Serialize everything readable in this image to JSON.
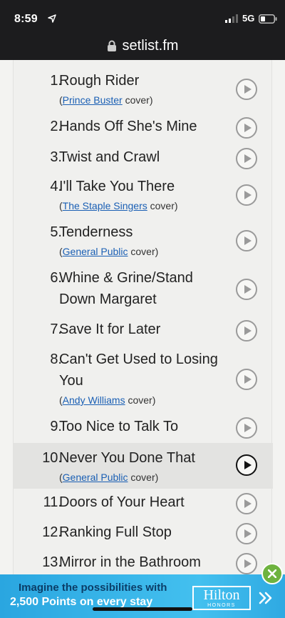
{
  "status_bar": {
    "time": "8:59",
    "network": "5G"
  },
  "browser": {
    "url": "setlist.fm"
  },
  "songs": [
    {
      "number": "1.",
      "title": "Rough Rider",
      "artist": "Prince Buster",
      "cover_suffix": "cover)"
    },
    {
      "number": "2.",
      "title": "Hands Off She's Mine"
    },
    {
      "number": "3.",
      "title": "Twist and Crawl"
    },
    {
      "number": "4.",
      "title": "I'll Take You There",
      "artist": "The Staple Singers",
      "cover_suffix": "cover)"
    },
    {
      "number": "5.",
      "title": "Tenderness",
      "artist": "General Public",
      "cover_suffix": "cover)"
    },
    {
      "number": "6.",
      "title": "Whine & Grine/Stand Down Margaret"
    },
    {
      "number": "7.",
      "title": "Save It for Later"
    },
    {
      "number": "8.",
      "title": "Can't Get Used to Losing You",
      "artist": "Andy Williams",
      "cover_suffix": "cover)"
    },
    {
      "number": "9.",
      "title": "Too Nice to Talk To"
    },
    {
      "number": "10.",
      "title": "Never You Done That",
      "artist": "General Public",
      "cover_suffix": "cover)"
    },
    {
      "number": "11.",
      "title": "Doors of Your Heart"
    },
    {
      "number": "12.",
      "title": "Ranking Full Stop"
    },
    {
      "number": "13.",
      "title": "Mirror in the Bathroom"
    }
  ],
  "ad": {
    "line1": "Imagine the possibilities with",
    "line2": "2,500 Points on every stay",
    "brand": "Hilton",
    "brand_sub": "HONORS"
  },
  "icons": {
    "lock": "lock-icon",
    "play": "play-icon",
    "close": "close-icon",
    "arrow": "chevron-right-icon"
  }
}
